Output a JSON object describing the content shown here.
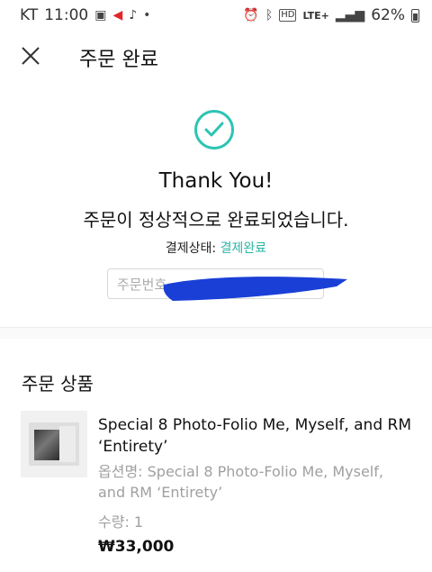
{
  "status_bar": {
    "carrier": "KT",
    "time": "11:00",
    "network": "LTE+",
    "hd": "HD",
    "battery": "62%"
  },
  "header": {
    "title": "주문 완료",
    "close_icon": "close-icon"
  },
  "confirmation": {
    "heading": "Thank You!",
    "message": "주문이 정상적으로 완료되었습니다.",
    "payment_status_label": "결제상태:",
    "payment_status_value": "결제완료",
    "order_number_label": "주문번호"
  },
  "order_items": {
    "section_title": "주문 상품",
    "items": [
      {
        "name": "Special 8 Photo-Folio Me, Myself, and RM ‘Entirety’",
        "option": "옵션명: Special 8 Photo-Folio Me, Myself, and RM ‘Entirety’",
        "quantity": "수량: 1",
        "price": "₩33,000"
      }
    ]
  },
  "colors": {
    "accent": "#2bc4b4",
    "redaction": "#1a3fd6"
  }
}
